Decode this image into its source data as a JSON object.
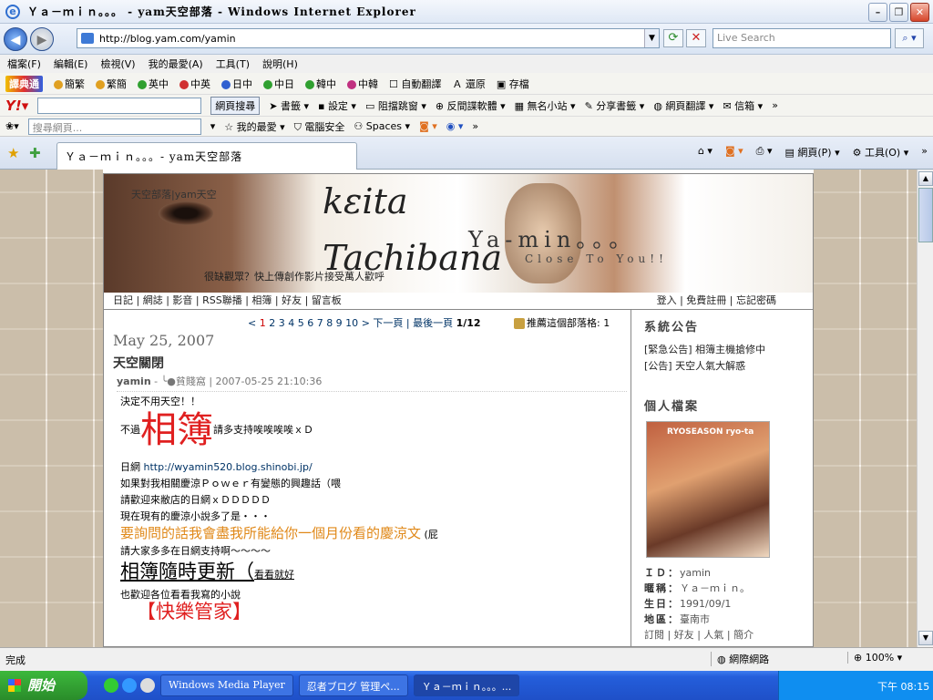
{
  "window": {
    "title": "Ｙａ－ｍｉｎ。。。 - yam天空部落 - Windows Internet Explorer"
  },
  "address": {
    "url": "http://blog.yam.com/yamin",
    "search_placeholder": "Live Search"
  },
  "menu": [
    "檔案(F)",
    "編輯(E)",
    "檢視(V)",
    "我的最愛(A)",
    "工具(T)",
    "說明(H)"
  ],
  "toolbar1": {
    "logo": "譯典通",
    "items": [
      "簡繁",
      "繁簡",
      "英中",
      "中英",
      "日中",
      "中日",
      "韓中",
      "中韓"
    ],
    "auto_translate": "自動翻譯",
    "restore": "還原",
    "save": "存檔"
  },
  "toolbar2": {
    "web_search": "網頁搜尋",
    "items": [
      "書籤",
      "設定",
      "阻擋跳窗",
      "反間諜軟體",
      "無名小站",
      "分享書籤",
      "網頁翻譯",
      "信箱"
    ]
  },
  "toolbar3": {
    "search_placeholder": "搜尋網頁...",
    "favorites": "我的最愛",
    "security": "電腦安全",
    "spaces": "Spaces"
  },
  "tab": {
    "label": "Ｙａ－ｍｉｎ。。。- yam天空部落",
    "tools": [
      "網頁(P)",
      "工具(O)"
    ]
  },
  "banner": {
    "blog_label": "天空部落|yam天空",
    "keita": "kεita",
    "tachibana": "Tachibana",
    "yamin": "Ya-min。。。",
    "close": "Close To You!!",
    "slogan": "很缺觀眾？快上傳創作影片接受萬人歡呼",
    "nav_left": "日記 | 網誌 | 影音 | RSS聯播 | 相簿 | 好友 | 留言板",
    "nav_right": "登入 | 免費註冊 | 忘記密碼"
  },
  "pager": {
    "prev": "<",
    "current": "1",
    "pages": "2 3 4 5 6 7 8 9 10",
    "next": "> 下一頁",
    "last": "| 最後一頁",
    "count": "1/12"
  },
  "recommend": "推薦這個部落格: 1",
  "post": {
    "date": "May 25, 2007",
    "title": "天空關閉",
    "author": "yamin",
    "category": "-  ╰●貧賤窩",
    "time": "| 2007-05-25 21:10:36",
    "line1": "決定不用天空！！",
    "line2_pre": "不過",
    "line2_big": "相簿",
    "line2_post": "請多支持唉唉唉唉ｘＤ",
    "line3_pre": "日網",
    "line3_link": "http://wyamin520.blog.shinobi.jp/",
    "line4": "如果對我相關慶涼Ｐｏｗｅｒ有變態的興趣話（喂",
    "line5": "請歡迎來敝店的日網ｘＤＤＤＤＤ",
    "line6": "現在現有的慶涼小說多了是・・・",
    "line7": "要詢問的話我會盡我所能給你一個月份看的慶涼文",
    "line7_post": "(屁",
    "line8": "請大家多多在日網支持啊～～～～",
    "line9_big": "相簿隨時更新（",
    "line9_small": "看看就好",
    "line10": "也歡迎各位看看我寫的小說",
    "line11": "【快樂管家】"
  },
  "sidebar": {
    "announce_title": "系統公告",
    "announcements": [
      "[緊急公告] 相簿主機搶修中",
      "[公告] 天空人氣大解惑"
    ],
    "profile_title": "個人檔案",
    "photo_label": "RYOSEASON ryo-ta",
    "profile": [
      {
        "k": "ＩＤ：",
        "v": "yamin"
      },
      {
        "k": "暱稱：",
        "v": "Ｙａ－ｍｉｎ。"
      },
      {
        "k": "生日：",
        "v": "1991/09/1"
      },
      {
        "k": "地區：",
        "v": "臺南市"
      }
    ],
    "bottom_links": "訂閱 | 好友 | 人氣 | 簡介"
  },
  "status": {
    "text": "完成",
    "zone": "網際網路",
    "zoom": "100%"
  },
  "taskbar": {
    "start": "開始",
    "tasks": [
      "Windows Media Player",
      "忍者ブログ 管理ペ...",
      "Ｙａ－ｍｉｎ。。。..."
    ],
    "clock": "下午 08:15"
  }
}
